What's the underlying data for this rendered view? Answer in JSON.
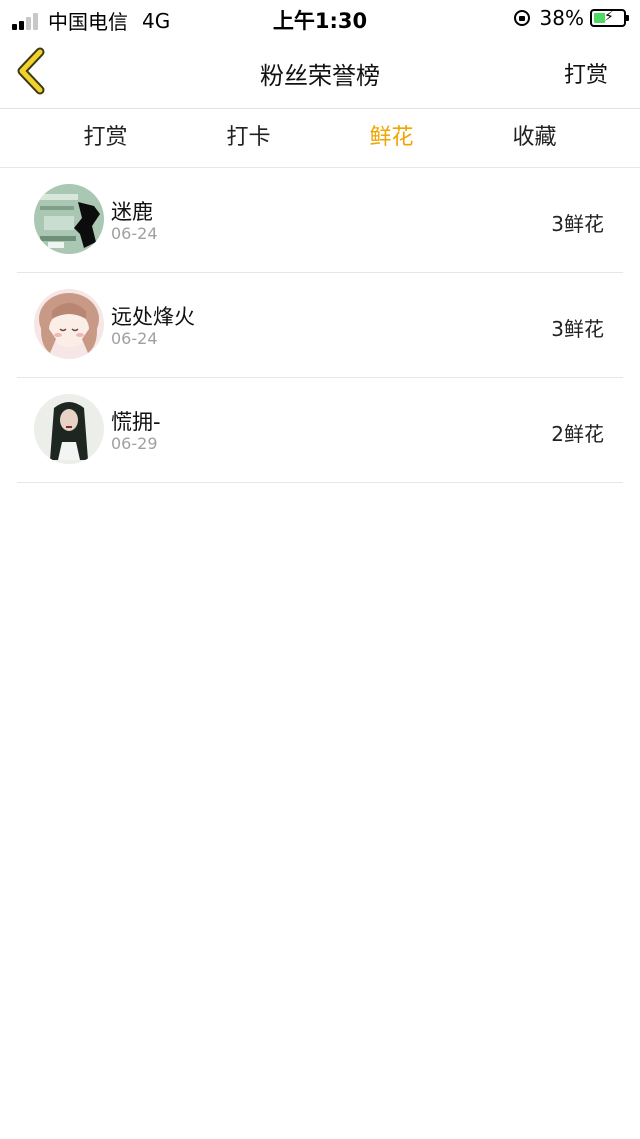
{
  "status_bar": {
    "carrier": "中国电信",
    "network": "4G",
    "time": "上午1:30",
    "battery": "38%",
    "battery_level": 0.38
  },
  "nav": {
    "title": "粉丝荣誉榜",
    "action": "打赏",
    "back_icon": "chevron-left-icon",
    "accent": "#f2d12a"
  },
  "tabs": [
    {
      "label": "打赏",
      "active": false
    },
    {
      "label": "打卡",
      "active": false
    },
    {
      "label": "鲜花",
      "active": true
    },
    {
      "label": "收藏",
      "active": false
    }
  ],
  "active_color": "#f0a500",
  "list": [
    {
      "name": "迷鹿",
      "date": "06-24",
      "value": "3鲜花"
    },
    {
      "name": "远处烽火",
      "date": "06-24",
      "value": "3鲜花"
    },
    {
      "name": "慌拥-",
      "date": "06-29",
      "value": "2鲜花"
    }
  ]
}
